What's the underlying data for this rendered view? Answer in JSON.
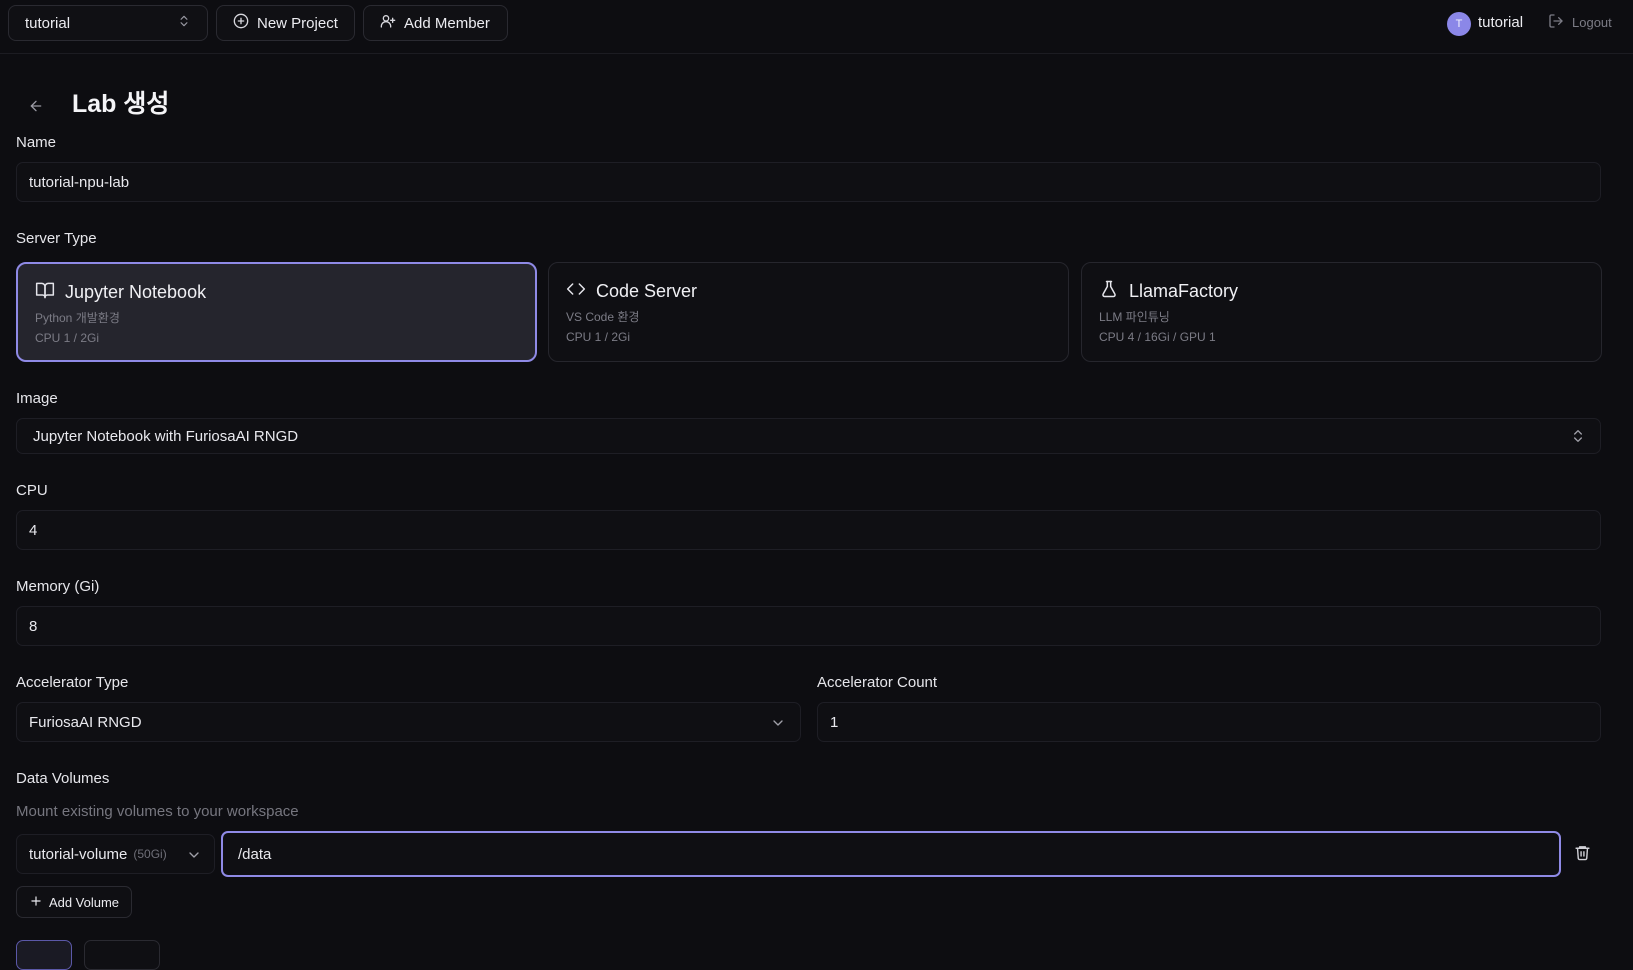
{
  "topbar": {
    "project": "tutorial",
    "new_project": "New Project",
    "add_member": "Add Member",
    "user_initial": "T",
    "user_name": "tutorial",
    "logout": "Logout"
  },
  "page": {
    "title": "Lab 생성"
  },
  "form": {
    "name_label": "Name",
    "name_value": "tutorial-npu-lab",
    "server_type_label": "Server Type",
    "server_types": [
      {
        "title": "Jupyter Notebook",
        "subtitle": "Python 개발환경",
        "spec": "CPU 1 / 2Gi",
        "icon": "book-open-icon",
        "selected": true
      },
      {
        "title": "Code Server",
        "subtitle": "VS Code 환경",
        "spec": "CPU 1 / 2Gi",
        "icon": "code-icon",
        "selected": false
      },
      {
        "title": "LlamaFactory",
        "subtitle": "LLM 파인튜닝",
        "spec": "CPU 4 / 16Gi / GPU 1",
        "icon": "flask-icon",
        "selected": false
      }
    ],
    "image_label": "Image",
    "image_value": "Jupyter Notebook with FuriosaAI RNGD",
    "cpu_label": "CPU",
    "cpu_value": "4",
    "memory_label": "Memory (Gi)",
    "memory_value": "8",
    "accel_type_label": "Accelerator Type",
    "accel_type_value": "FuriosaAI RNGD",
    "accel_count_label": "Accelerator Count",
    "accel_count_value": "1",
    "volumes_label": "Data Volumes",
    "volumes_helper": "Mount existing volumes to your workspace",
    "volume_name": "tutorial-volume",
    "volume_size": "(50Gi)",
    "mount_path": "/data",
    "add_volume": "Add Volume"
  },
  "colors": {
    "accent": "#8f8ae6",
    "background": "#0d0d11",
    "selected_card": "#25252d"
  }
}
